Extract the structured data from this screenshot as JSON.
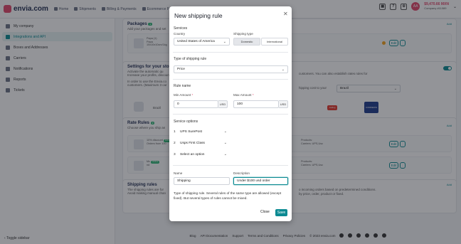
{
  "brand": {
    "name": "envia.com"
  },
  "nav": [
    {
      "label": "Home",
      "icon": "home-icon"
    },
    {
      "label": "Shipments",
      "icon": "box-icon"
    },
    {
      "label": "Billing & Payments",
      "icon": "card-icon"
    },
    {
      "label": "Ecommerce P",
      "icon": "cart-icon"
    }
  ],
  "account": {
    "balance": "$9,470.66 MXN",
    "company": "Company #11089",
    "initials": "AA",
    "help": "?"
  },
  "sidebar": {
    "items": [
      {
        "label": "My company",
        "icon": "gear-icon"
      },
      {
        "label": "Integrations and API",
        "icon": "plug-icon"
      },
      {
        "label": "Boxes and Addresses",
        "icon": "box-icon"
      },
      {
        "label": "Carriers",
        "icon": "truck-icon"
      },
      {
        "label": "Notifications",
        "icon": "bell-icon"
      },
      {
        "label": "Reports",
        "icon": "chart-icon"
      },
      {
        "label": "Tickets",
        "icon": "ticket-icon"
      }
    ],
    "toggle": "Toggle sidebar"
  },
  "packages": {
    "title": "Packages",
    "count": "1",
    "desc": "Add your packages and set",
    "add": "Add",
    "item": {
      "line1": "Papa (1)",
      "line2": "Papa",
      "line3": "10x10x10cm/1kg"
    },
    "edit": "Edit"
  },
  "settings": {
    "title": "Settings for your stor",
    "desc1": "Activate the automatic qu",
    "desc2": "Increase your profits, discount/increase",
    "desc3": "In order to use the Envia.co",
    "desc4": "customers. (Maximum 3 car",
    "right_desc": "customers. You can also establish rates rules for",
    "right_desc2": "hipping cost to your",
    "country_label": "Brazil",
    "city": "Brazil",
    "carrier1": "Jadlog",
    "carrier2": "CORREIOS"
  },
  "rate_rules": {
    "title": "Rate Rules",
    "count": "2",
    "desc": "Choose where you ship an",
    "add": "Add",
    "rule1": {
      "line1": "10% discount",
      "line2": "Orders from 100",
      "badge": "Active",
      "products": "Products:",
      "carrier": "Carriers: UPS,Usc"
    },
    "rule2": {
      "line1": "Mc",
      "line2": "nd",
      "badge": "Active",
      "products": "Products:",
      "carrier": "Carriers: UPS,Usc"
    },
    "edit": "Edit"
  },
  "shipping_rules": {
    "title": "Shipping rules",
    "desc1": "The shipping rules are for",
    "desc2": "Avoid making manual chan",
    "right1": "o incoming orders based on predetermined conditions.",
    "right2": "by price, order, product or fixed.",
    "add": "Add"
  },
  "footer": {
    "links": [
      "Blog",
      "API Documentation",
      "Support",
      "Terms and Conditions",
      "Privacy Policies",
      "© 2023 envia.com"
    ]
  },
  "modal": {
    "title": "New shipping rule",
    "services_section": "Services",
    "country_label": "Country",
    "country_value": "United States of America",
    "shipping_type_label": "Shipping type",
    "shipping_type_options": [
      "Domestic",
      "International"
    ],
    "type_section": "Type of shipping rule",
    "type_value": "Price",
    "rule_name_section": "Rule name",
    "min_label": "Min Amount",
    "min_value": "0",
    "max_label": "Max Amount",
    "max_value": "100",
    "currency": "USD",
    "service_options_section": "Service options",
    "services": [
      {
        "num": "1",
        "value": "UPS SurePost"
      },
      {
        "num": "2",
        "value": "Usps First Class"
      },
      {
        "num": "3",
        "value": "Select an option"
      }
    ],
    "name_label": "Name",
    "name_value": "Shipping",
    "description_label": "Description",
    "description_value": "Under $100 usd order",
    "note": "Type of shipping rule. Several rules of the same type are allowed (except fixed). But several types of rules cannot be mixed.",
    "close_label": "Close",
    "save_label": "Save"
  }
}
